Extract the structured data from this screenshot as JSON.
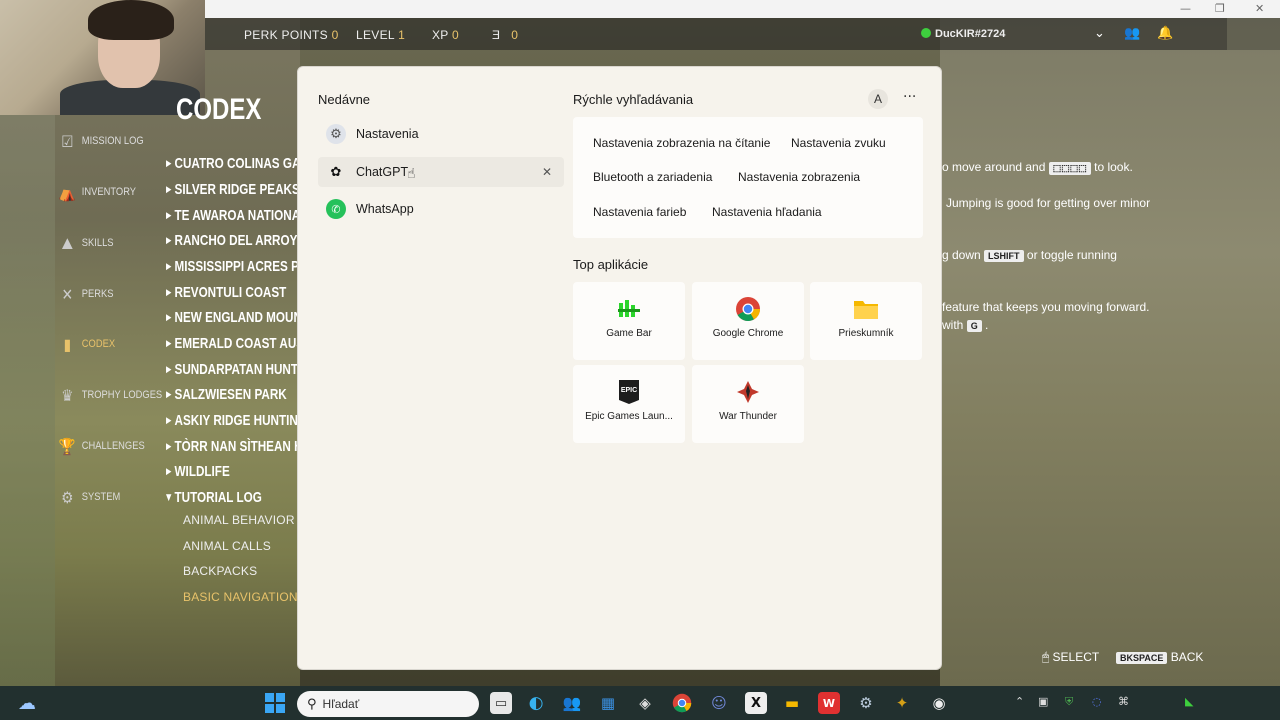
{
  "window": {
    "minimize": "—",
    "maximize": "❐",
    "close": "✕"
  },
  "hud": {
    "perk_points_label": "PERK POINTS",
    "perk_points_value": "0",
    "level_label": "LEVEL",
    "level_value": "1",
    "xp_label": "XP",
    "xp_value": "0",
    "currency_icon": "Ǝ",
    "currency_value": "0",
    "player_name": "DucKIR#2724",
    "dropdown_icon": "chevron-down-icon",
    "friends_icon": "friends-icon",
    "bell_icon": "bell-icon"
  },
  "game": {
    "codex_title": "CODEX",
    "menu": [
      {
        "label": "MISSION LOG"
      },
      {
        "label": "INVENTORY"
      },
      {
        "label": "SKILLS"
      },
      {
        "label": "PERKS"
      },
      {
        "label": "CODEX"
      },
      {
        "label": "TROPHY LODGES"
      },
      {
        "label": "CHALLENGES"
      },
      {
        "label": "SYSTEM"
      }
    ],
    "regions": [
      "CUATRO COLINAS GAME PRESERVE",
      "SILVER RIDGE PEAKS",
      "TE AWAROA NATIONAL PARK",
      "RANCHO DEL ARROYO",
      "MISSISSIPPI ACRES PRESERVE",
      "REVONTULI COAST",
      "NEW ENGLAND MOUNTAINS",
      "EMERALD COAST AUSTRALIA",
      "SUNDARPATAN HUNTING RESERVE",
      "SALZWIESEN PARK",
      "ASKIY RIDGE HUNTING PRESERVE",
      "TÒRR NAN SÌTHEAN HUNTING RESERVE",
      "WILDLIFE",
      "TUTORIAL LOG"
    ],
    "tutorial_items": [
      "ANIMAL BEHAVIOR",
      "ANIMAL CALLS",
      "BACKPACKS",
      "BASIC NAVIGATION"
    ],
    "hints": {
      "line1": "o move around and",
      "line1_keys": "⬚⬚⬚⬚",
      "line1_end": "to look.",
      "line2": "Jumping is good for getting over minor",
      "line3_start": "g down",
      "line3_key": "LSHIFT",
      "line3_end": "or toggle running",
      "line4": "feature that keeps you moving forward.",
      "line5_start": "with",
      "line5_key": "G"
    },
    "bottom": {
      "select": "SELECT",
      "back_key": "BKSPACE",
      "back": "BACK"
    }
  },
  "start_menu": {
    "recent_title": "Nedávne",
    "recent": [
      {
        "label": "Nastavenia",
        "icon": "settings-gear-icon"
      },
      {
        "label": "ChatGPT",
        "icon": "chatgpt-icon"
      },
      {
        "label": "WhatsApp",
        "icon": "whatsapp-icon"
      }
    ],
    "recent_close": "✕",
    "quick_title": "Rýchle vyhľadávania",
    "account_initial": "A",
    "more_label": "···",
    "quick": [
      "Nastavenia zobrazenia na čítanie",
      "Nastavenia zvuku",
      "Bluetooth a zariadenia",
      "Nastavenia zobrazenia",
      "Nastavenia farieb",
      "Nastavenia hľadania"
    ],
    "top_title": "Top aplikácie",
    "apps": [
      {
        "label": "Game Bar",
        "icon": "game-bar-icon"
      },
      {
        "label": "Google Chrome",
        "icon": "chrome-icon"
      },
      {
        "label": "Prieskumník",
        "icon": "folder-icon"
      },
      {
        "label": "Epic Games Laun...",
        "icon": "epic-games-icon"
      },
      {
        "label": "War Thunder",
        "icon": "war-thunder-icon"
      }
    ]
  },
  "taskbar": {
    "search_placeholder": "Hľadať",
    "apps": [
      "start",
      "task-view",
      "edge",
      "teams",
      "store",
      "unity",
      "chrome",
      "discord",
      "x",
      "explorer",
      "wps",
      "steam",
      "league",
      "obs"
    ]
  }
}
